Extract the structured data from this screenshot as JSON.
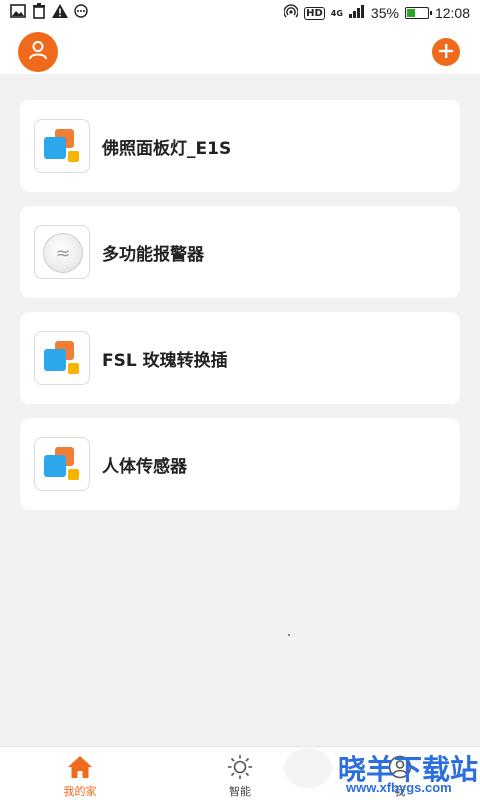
{
  "status_bar": {
    "left_icons": [
      "image-icon",
      "trash-icon",
      "warning-icon",
      "more-icon"
    ],
    "right_icons": [
      "hotspot-icon",
      "hd-icon",
      "signal-icon"
    ],
    "network": "4G",
    "battery": "35%",
    "battery_level": 0.35,
    "time": "12:08"
  },
  "header": {
    "avatar_icon": "user-icon",
    "add_icon": "plus-icon",
    "accent": "#f06a1b"
  },
  "devices": [
    {
      "name": "佛照面板灯_E1S",
      "icon": "tile-icon"
    },
    {
      "name": "多功能报警器",
      "icon": "sensor-icon"
    },
    {
      "name": "FSL 玫瑰转换插",
      "icon": "tile-icon"
    },
    {
      "name": "人体传感器",
      "icon": "tile-icon"
    }
  ],
  "tabs": [
    {
      "label": "我的家",
      "icon": "home-icon",
      "active": true
    },
    {
      "label": "智能",
      "icon": "sun-icon",
      "active": false
    },
    {
      "label": "我",
      "icon": "user-icon",
      "active": false
    }
  ],
  "watermark": {
    "text": "晓羊下载站",
    "url": "www.xfbygs.com"
  }
}
